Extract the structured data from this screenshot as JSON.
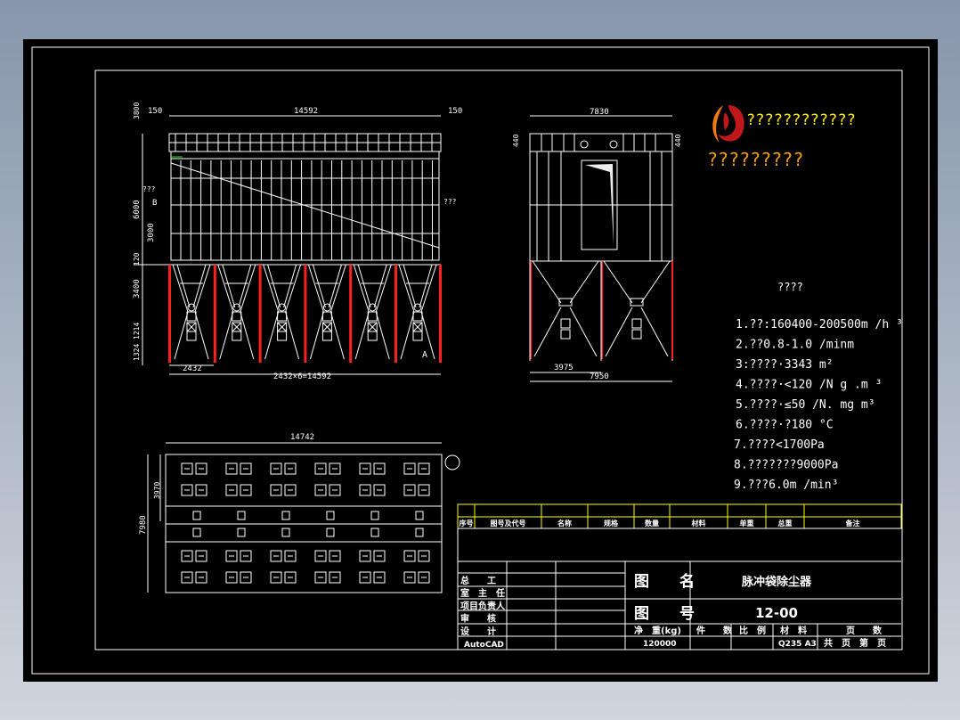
{
  "front_view": {
    "dims": {
      "top_total": "14592",
      "top_left": "150",
      "top_right": "150",
      "bottom_total": "2432×6=14592",
      "bay": "2432",
      "h_roof": "3800",
      "h_body": "6000",
      "h_half": "3000",
      "h_ring": "120",
      "h_hopper": "3400",
      "h_a": "1214",
      "h_b": "1324"
    },
    "section_b_label": "???",
    "section_b_letter": "B",
    "outlet_label": "???",
    "view_a_letter": "A",
    "bays": 6
  },
  "side_view": {
    "dims": {
      "top": "7830",
      "h_left": "440",
      "h_right": "440",
      "half": "3975",
      "bottom": "7950"
    },
    "bays": 2
  },
  "plan_view": {
    "dims": {
      "length": "14742",
      "half_width": "3970",
      "width": "7980"
    }
  },
  "logo": {
    "line1": "????????????",
    "line2": "?????????",
    "colors": {
      "red": "#c0171a",
      "orange": "#f07a10",
      "yellow": "#ffd700"
    }
  },
  "specs": {
    "title": "????",
    "items": [
      "1.??:160400-200500m /h ³",
      "2.??0.8-1.0  /minm",
      "3:????·3343        m²",
      "4.????·<120 /N    g  .m ³",
      "5.????·≤50   /N. mg     m³",
      "6.????·?180          °C",
      "7.????<1700Pa",
      "8.???????9000Pa",
      "9.???6.0m /min³"
    ]
  },
  "parts_table": {
    "headers": [
      "序号",
      "图号及代号",
      "名称",
      "规格",
      "数量",
      "材料",
      "单重",
      "总重",
      "备注"
    ]
  },
  "title_block": {
    "roles": [
      "总　　工",
      "室　主　任",
      "项目负责人",
      "审　　核",
      "设　　计"
    ],
    "software": "AutoCAD",
    "drawing_name_label": "图　　名",
    "drawing_name": "脉冲袋除尘器",
    "drawing_no_label": "图　　号",
    "drawing_no": "12-00",
    "weight_label": "净　重(kg)",
    "weight": "120000",
    "pieces_label": "件　　数",
    "scale_label": "比　例",
    "material_label": "材　料",
    "material": "Q235 A3",
    "pages_label": "页　　数",
    "pages_value": "共　页　第　页"
  },
  "colors": {
    "line": "#ffffff",
    "highlight": "#ff2020",
    "table": "#ffff00",
    "green": "#00ff00"
  }
}
